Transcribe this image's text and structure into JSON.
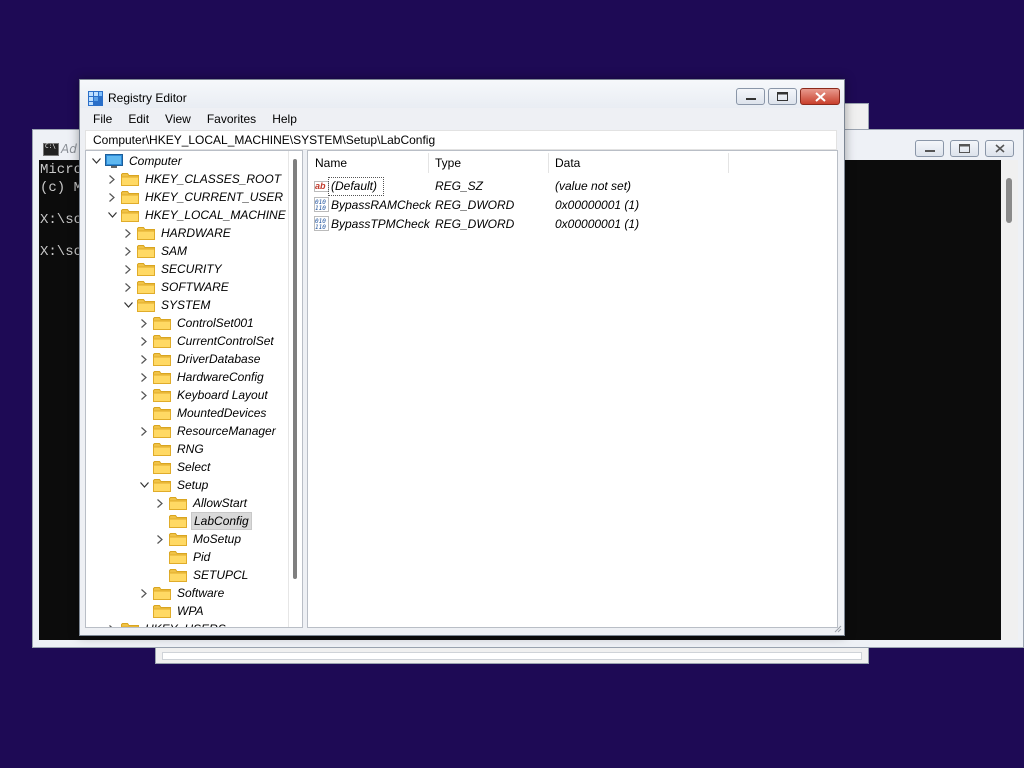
{
  "back_window": {},
  "cmd_window": {
    "title": "Ad",
    "lines": [
      "Micro",
      "(c) M",
      "",
      "X:\\so",
      "",
      "X:\\so"
    ]
  },
  "registry": {
    "title": "Registry Editor",
    "menu": [
      "File",
      "Edit",
      "View",
      "Favorites",
      "Help"
    ],
    "address": "Computer\\HKEY_LOCAL_MACHINE\\SYSTEM\\Setup\\LabConfig",
    "tree": [
      {
        "label": "Computer",
        "depth": 0,
        "expander": "expanded",
        "icon": "computer-icon"
      },
      {
        "label": "HKEY_CLASSES_ROOT",
        "depth": 1,
        "expander": "collapsed",
        "icon": "folder-icon"
      },
      {
        "label": "HKEY_CURRENT_USER",
        "depth": 1,
        "expander": "collapsed",
        "icon": "folder-icon"
      },
      {
        "label": "HKEY_LOCAL_MACHINE",
        "depth": 1,
        "expander": "expanded",
        "icon": "folder-icon"
      },
      {
        "label": "HARDWARE",
        "depth": 2,
        "expander": "collapsed",
        "icon": "folder-icon"
      },
      {
        "label": "SAM",
        "depth": 2,
        "expander": "collapsed",
        "icon": "folder-icon"
      },
      {
        "label": "SECURITY",
        "depth": 2,
        "expander": "collapsed",
        "icon": "folder-icon"
      },
      {
        "label": "SOFTWARE",
        "depth": 2,
        "expander": "collapsed",
        "icon": "folder-icon"
      },
      {
        "label": "SYSTEM",
        "depth": 2,
        "expander": "expanded",
        "icon": "folder-icon"
      },
      {
        "label": "ControlSet001",
        "depth": 3,
        "expander": "collapsed",
        "icon": "folder-icon"
      },
      {
        "label": "CurrentControlSet",
        "depth": 3,
        "expander": "collapsed",
        "icon": "folder-icon"
      },
      {
        "label": "DriverDatabase",
        "depth": 3,
        "expander": "collapsed",
        "icon": "folder-icon"
      },
      {
        "label": "HardwareConfig",
        "depth": 3,
        "expander": "collapsed",
        "icon": "folder-icon"
      },
      {
        "label": "Keyboard Layout",
        "depth": 3,
        "expander": "collapsed",
        "icon": "folder-icon"
      },
      {
        "label": "MountedDevices",
        "depth": 3,
        "expander": "none",
        "icon": "folder-icon"
      },
      {
        "label": "ResourceManager",
        "depth": 3,
        "expander": "collapsed",
        "icon": "folder-icon"
      },
      {
        "label": "RNG",
        "depth": 3,
        "expander": "none",
        "icon": "folder-icon"
      },
      {
        "label": "Select",
        "depth": 3,
        "expander": "none",
        "icon": "folder-icon"
      },
      {
        "label": "Setup",
        "depth": 3,
        "expander": "expanded",
        "icon": "folder-icon"
      },
      {
        "label": "AllowStart",
        "depth": 4,
        "expander": "collapsed",
        "icon": "folder-icon"
      },
      {
        "label": "LabConfig",
        "depth": 4,
        "expander": "none",
        "icon": "folder-icon",
        "selected": true
      },
      {
        "label": "MoSetup",
        "depth": 4,
        "expander": "collapsed",
        "icon": "folder-icon"
      },
      {
        "label": "Pid",
        "depth": 4,
        "expander": "none",
        "icon": "folder-icon"
      },
      {
        "label": "SETUPCL",
        "depth": 4,
        "expander": "none",
        "icon": "folder-icon"
      },
      {
        "label": "Software",
        "depth": 3,
        "expander": "collapsed",
        "icon": "folder-icon"
      },
      {
        "label": "WPA",
        "depth": 3,
        "expander": "none",
        "icon": "folder-icon"
      },
      {
        "label": "HKEY_USERS",
        "depth": 1,
        "expander": "collapsed",
        "icon": "folder-icon"
      }
    ],
    "columns": [
      "Name",
      "Type",
      "Data"
    ],
    "values": [
      {
        "name": "(Default)",
        "type": "REG_SZ",
        "data": "(value not set)",
        "icon": "string-value-icon"
      },
      {
        "name": "BypassRAMCheck",
        "type": "REG_DWORD",
        "data": "0x00000001 (1)",
        "icon": "binary-value-icon"
      },
      {
        "name": "BypassTPMCheck",
        "type": "REG_DWORD",
        "data": "0x00000001 (1)",
        "icon": "binary-value-icon"
      }
    ]
  }
}
